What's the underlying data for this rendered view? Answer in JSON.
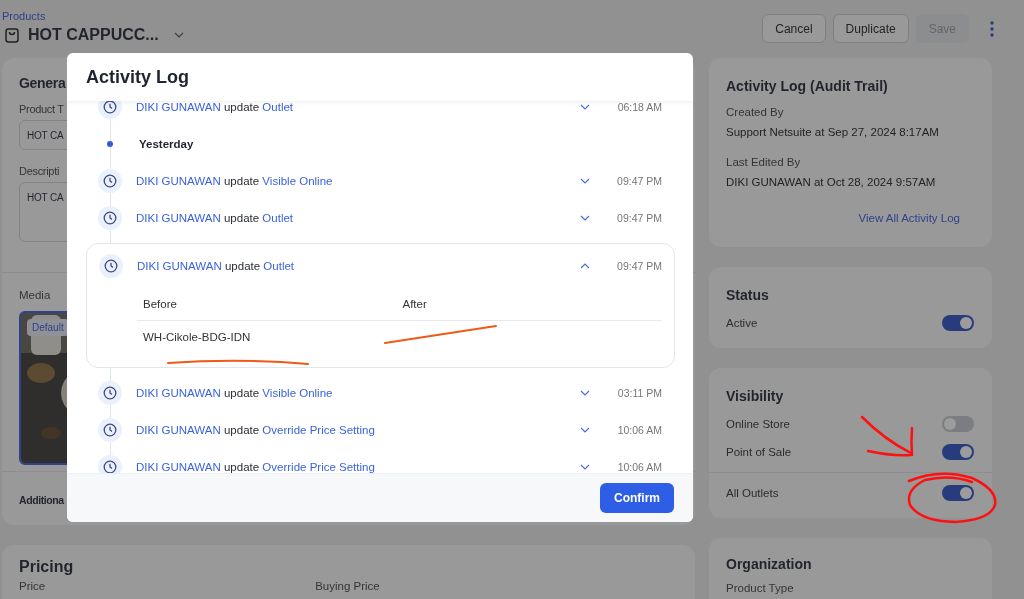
{
  "breadcrumb": "Products",
  "title": "HOT CAPPUCC...",
  "header_buttons": [
    {
      "label": "Cancel",
      "disabled": false
    },
    {
      "label": "Duplicate",
      "disabled": false
    },
    {
      "label": "Save",
      "disabled": true
    }
  ],
  "general": {
    "heading": "Genera",
    "fields": [
      {
        "label": "Product T",
        "value": "HOT CA",
        "kind": "input"
      },
      {
        "label": "Descripti",
        "value": "HOT CA",
        "kind": "textarea"
      }
    ],
    "media_label": "Media",
    "media_badge": "Default",
    "additional": "Additiona"
  },
  "pricing": {
    "heading": "Pricing",
    "labels": [
      "Price",
      "Buying Price"
    ]
  },
  "audit": {
    "heading": "Activity Log (Audit Trail)",
    "items": [
      {
        "label": "Created By",
        "value": "Support Netsuite at Sep 27, 2024 8:17AM"
      },
      {
        "label": "Last Edited By",
        "value": "DIKI GUNAWAN at Oct 28, 2024 9:57AM"
      }
    ],
    "link": "View All Activity Log"
  },
  "status": {
    "heading": "Status",
    "toggles": [
      {
        "label": "Active",
        "on": true
      }
    ]
  },
  "visibility": {
    "heading": "Visibility",
    "toggles": [
      {
        "label": "Online Store",
        "on": false
      },
      {
        "label": "Point of Sale",
        "on": true
      },
      {
        "label": "All Outlets",
        "on": true
      }
    ]
  },
  "organization": {
    "heading": "Organization",
    "label": "Product Type"
  },
  "modal": {
    "title": "Activity Log",
    "entries": [
      {
        "kind": "event",
        "user": "DIKI GUNAWAN",
        "action": "update",
        "field": "Outlet",
        "time": "06:18 AM",
        "expanded": false
      },
      {
        "kind": "date",
        "label": "Yesterday"
      },
      {
        "kind": "event",
        "user": "DIKI GUNAWAN",
        "action": "update",
        "field": "Visible Online",
        "time": "09:47 PM",
        "expanded": false
      },
      {
        "kind": "event",
        "user": "DIKI GUNAWAN",
        "action": "update",
        "field": "Outlet",
        "time": "09:47 PM",
        "expanded": false
      },
      {
        "kind": "event",
        "user": "DIKI GUNAWAN",
        "action": "update",
        "field": "Outlet",
        "time": "09:47 PM",
        "expanded": true,
        "details": {
          "columns": [
            "Before",
            "After"
          ],
          "rows": [
            {
              "before": "WH-Cikole-BDG-IDN"
            }
          ]
        }
      },
      {
        "kind": "event",
        "user": "DIKI GUNAWAN",
        "action": "update",
        "field": "Visible Online",
        "time": "03:11 PM",
        "expanded": false
      },
      {
        "kind": "event",
        "user": "DIKI GUNAWAN",
        "action": "update",
        "field": "Override Price Setting",
        "time": "10:06 AM",
        "expanded": false
      },
      {
        "kind": "event",
        "user": "DIKI GUNAWAN",
        "action": "update",
        "field": "Override Price Setting",
        "time": "10:06 AM",
        "expanded": false
      }
    ],
    "confirm": "Confirm"
  }
}
